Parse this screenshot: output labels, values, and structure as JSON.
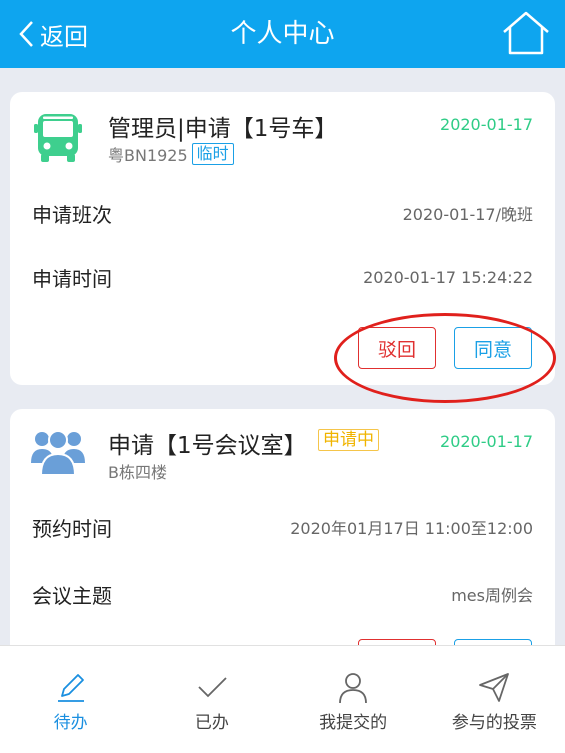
{
  "header": {
    "back_label": "返回",
    "title": "个人中心",
    "back_icon": "chevron-left-icon",
    "home_icon": "home-icon"
  },
  "cards": [
    {
      "icon": "bus-icon",
      "icon_color": "#3ecf8e",
      "title": "管理员|申请【1号车】",
      "subtitle": "粤BN1925",
      "tag": "临时",
      "date": "2020-01-17",
      "rows": [
        {
          "label": "申请班次",
          "value": "2020-01-17/晚班"
        },
        {
          "label": "申请时间",
          "value": "2020-01-17 15:24:22"
        }
      ],
      "buttons": {
        "reject": "驳回",
        "agree": "同意"
      }
    },
    {
      "icon": "group-icon",
      "icon_color": "#6a9fd8",
      "title": "申请【1号会议室】",
      "subtitle": "B栋四楼",
      "tag": "申请中",
      "date": "2020-01-17",
      "rows": [
        {
          "label": "预约时间",
          "value": "2020年01月17日  11:00至12:00"
        },
        {
          "label": "会议主题",
          "value": "mes周例会"
        }
      ]
    }
  ],
  "tabbar": [
    {
      "label": "待办",
      "icon": "pencil-icon",
      "active": true
    },
    {
      "label": "已办",
      "icon": "check-icon",
      "active": false
    },
    {
      "label": "我提交的",
      "icon": "user-icon",
      "active": false
    },
    {
      "label": "参与的投票",
      "icon": "send-icon",
      "active": false
    }
  ],
  "colors": {
    "header_bg": "#0ea5ef",
    "date_green": "#2ecc86",
    "reject_red": "#e03030",
    "agree_blue": "#1aa0e6",
    "tab_active": "#1a8fe0",
    "annotation_red": "#e0201c"
  }
}
